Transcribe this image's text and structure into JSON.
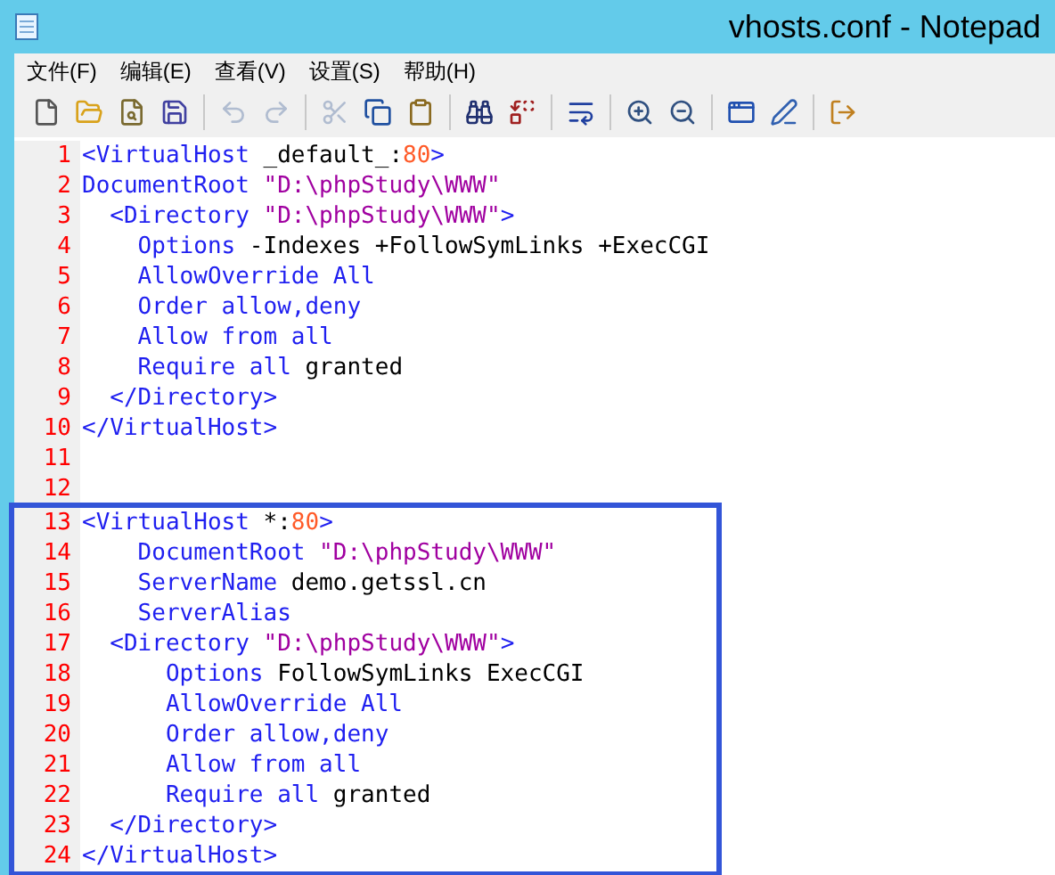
{
  "window": {
    "title": "vhosts.conf - Notepad"
  },
  "menu": [
    "文件(F)",
    "编辑(E)",
    "查看(V)",
    "设置(S)",
    "帮助(H)"
  ],
  "toolbar": [
    [
      {
        "kind": "new",
        "disabled": false
      },
      {
        "kind": "open",
        "disabled": false
      },
      {
        "kind": "browse",
        "disabled": false
      },
      {
        "kind": "save",
        "disabled": false
      }
    ],
    [
      {
        "kind": "undo",
        "disabled": true
      },
      {
        "kind": "redo",
        "disabled": true
      }
    ],
    [
      {
        "kind": "cut",
        "disabled": true
      },
      {
        "kind": "copy",
        "disabled": false
      },
      {
        "kind": "paste",
        "disabled": false
      }
    ],
    [
      {
        "kind": "find",
        "disabled": false
      },
      {
        "kind": "replace",
        "disabled": false
      }
    ],
    [
      {
        "kind": "wrap",
        "disabled": false
      }
    ],
    [
      {
        "kind": "zoomin",
        "disabled": false
      },
      {
        "kind": "zoomout",
        "disabled": false
      }
    ],
    [
      {
        "kind": "window",
        "disabled": false
      },
      {
        "kind": "edit",
        "disabled": false
      }
    ],
    [
      {
        "kind": "exit",
        "disabled": false
      }
    ]
  ],
  "editor": {
    "sections": [
      {
        "boxed": false,
        "lines": [
          {
            "number": "1",
            "tokens": [
              {
                "kind": "tag",
                "text": "<VirtualHost"
              },
              {
                "kind": "plain",
                "text": " _default_:"
              },
              {
                "kind": "number",
                "text": "80"
              },
              {
                "kind": "tag",
                "text": ">"
              }
            ]
          },
          {
            "number": "2",
            "tokens": [
              {
                "kind": "keyword",
                "text": "DocumentRoot"
              },
              {
                "kind": "string",
                "text": " \"D:\\phpStudy\\WWW\""
              }
            ]
          },
          {
            "number": "3",
            "tokens": [
              {
                "kind": "tag",
                "text": "  <Directory"
              },
              {
                "kind": "string",
                "text": " \"D:\\phpStudy\\WWW\""
              },
              {
                "kind": "tag",
                "text": ">"
              }
            ]
          },
          {
            "number": "4",
            "tokens": [
              {
                "kind": "keyword",
                "text": "    Options"
              },
              {
                "kind": "plain",
                "text": " -Indexes +FollowSymLinks +ExecCGI"
              }
            ]
          },
          {
            "number": "5",
            "tokens": [
              {
                "kind": "keyword",
                "text": "    AllowOverride All"
              }
            ]
          },
          {
            "number": "6",
            "tokens": [
              {
                "kind": "keyword",
                "text": "    Order allow,deny"
              }
            ]
          },
          {
            "number": "7",
            "tokens": [
              {
                "kind": "keyword",
                "text": "    Allow from all"
              }
            ]
          },
          {
            "number": "8",
            "tokens": [
              {
                "kind": "keyword",
                "text": "    Require all"
              },
              {
                "kind": "plain",
                "text": " granted"
              }
            ]
          },
          {
            "number": "9",
            "tokens": [
              {
                "kind": "tag",
                "text": "  </Directory>"
              }
            ]
          },
          {
            "number": "10",
            "tokens": [
              {
                "kind": "tag",
                "text": "</VirtualHost>"
              }
            ]
          },
          {
            "number": "11"
          },
          {
            "number": "12"
          }
        ]
      },
      {
        "boxed": true,
        "lines": [
          {
            "number": "13",
            "tokens": [
              {
                "kind": "tag",
                "text": "<VirtualHost"
              },
              {
                "kind": "plain",
                "text": " *:"
              },
              {
                "kind": "number",
                "text": "80"
              },
              {
                "kind": "tag",
                "text": ">"
              }
            ]
          },
          {
            "number": "14",
            "tokens": [
              {
                "kind": "keyword",
                "text": "    DocumentRoot"
              },
              {
                "kind": "string",
                "text": " \"D:\\phpStudy\\WWW\""
              }
            ]
          },
          {
            "number": "15",
            "tokens": [
              {
                "kind": "keyword",
                "text": "    ServerName"
              },
              {
                "kind": "plain",
                "text": " demo.getssl.cn"
              }
            ]
          },
          {
            "number": "16",
            "tokens": [
              {
                "kind": "keyword",
                "text": "    ServerAlias"
              }
            ]
          },
          {
            "number": "17",
            "tokens": [
              {
                "kind": "tag",
                "text": "  <Directory"
              },
              {
                "kind": "string",
                "text": " \"D:\\phpStudy\\WWW\""
              },
              {
                "kind": "tag",
                "text": ">"
              }
            ]
          },
          {
            "number": "18",
            "tokens": [
              {
                "kind": "keyword",
                "text": "      Options"
              },
              {
                "kind": "plain",
                "text": " FollowSymLinks ExecCGI"
              }
            ]
          },
          {
            "number": "19",
            "tokens": [
              {
                "kind": "keyword",
                "text": "      AllowOverride All"
              }
            ]
          },
          {
            "number": "20",
            "tokens": [
              {
                "kind": "keyword",
                "text": "      Order allow,deny"
              }
            ]
          },
          {
            "number": "21",
            "tokens": [
              {
                "kind": "keyword",
                "text": "      Allow from all"
              }
            ]
          },
          {
            "number": "22",
            "tokens": [
              {
                "kind": "keyword",
                "text": "      Require all"
              },
              {
                "kind": "plain",
                "text": " granted"
              }
            ]
          },
          {
            "number": "23",
            "tokens": [
              {
                "kind": "tag",
                "text": "  </Directory>"
              }
            ]
          },
          {
            "number": "24",
            "tokens": [
              {
                "kind": "tag",
                "text": "</VirtualHost>"
              }
            ]
          }
        ]
      }
    ]
  }
}
